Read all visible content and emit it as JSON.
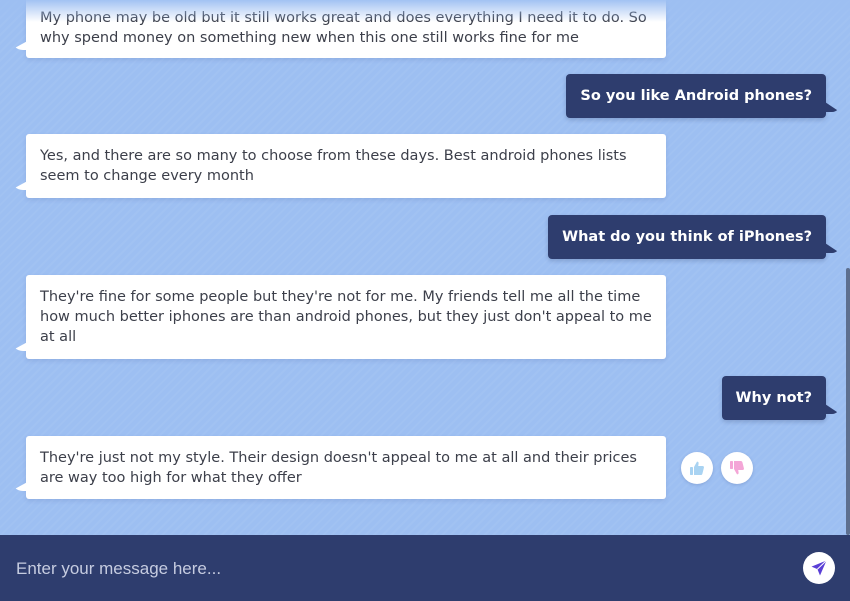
{
  "messages": [
    {
      "role": "bot",
      "text": "My phone may be old but it still works great and does everything I need it to do. So why spend money on something new when this one still works fine for me"
    },
    {
      "role": "user",
      "text": "So you like Android phones?"
    },
    {
      "role": "bot",
      "text": "Yes, and there are so many to choose from these days. Best android phones lists seem to change every month"
    },
    {
      "role": "user",
      "text": "What do you think of iPhones?"
    },
    {
      "role": "bot",
      "text": "They're fine for some people but they're not for me. My friends tell me all the time how much better iphones are than android phones, but they just don't appeal to me at all"
    },
    {
      "role": "user",
      "text": "Why not?"
    },
    {
      "role": "bot",
      "text": "They're just not my style. Their design doesn't appeal to me at all and their prices are way too high for what they offer"
    }
  ],
  "reactions": {
    "thumbs_up_icon": "thumbs-up-icon",
    "thumbs_down_icon": "thumbs-down-icon",
    "thumbs_up_color": "#a9d3f2",
    "thumbs_down_color": "#f4a6d7"
  },
  "composer": {
    "placeholder": "Enter your message here...",
    "value": "",
    "send_icon": "send-icon"
  },
  "colors": {
    "background": "#9dbff2",
    "user_bubble": "#2e3d6e",
    "bot_bubble": "#ffffff",
    "composer": "#2e3d6e",
    "send_icon": "#5a3fd6"
  }
}
